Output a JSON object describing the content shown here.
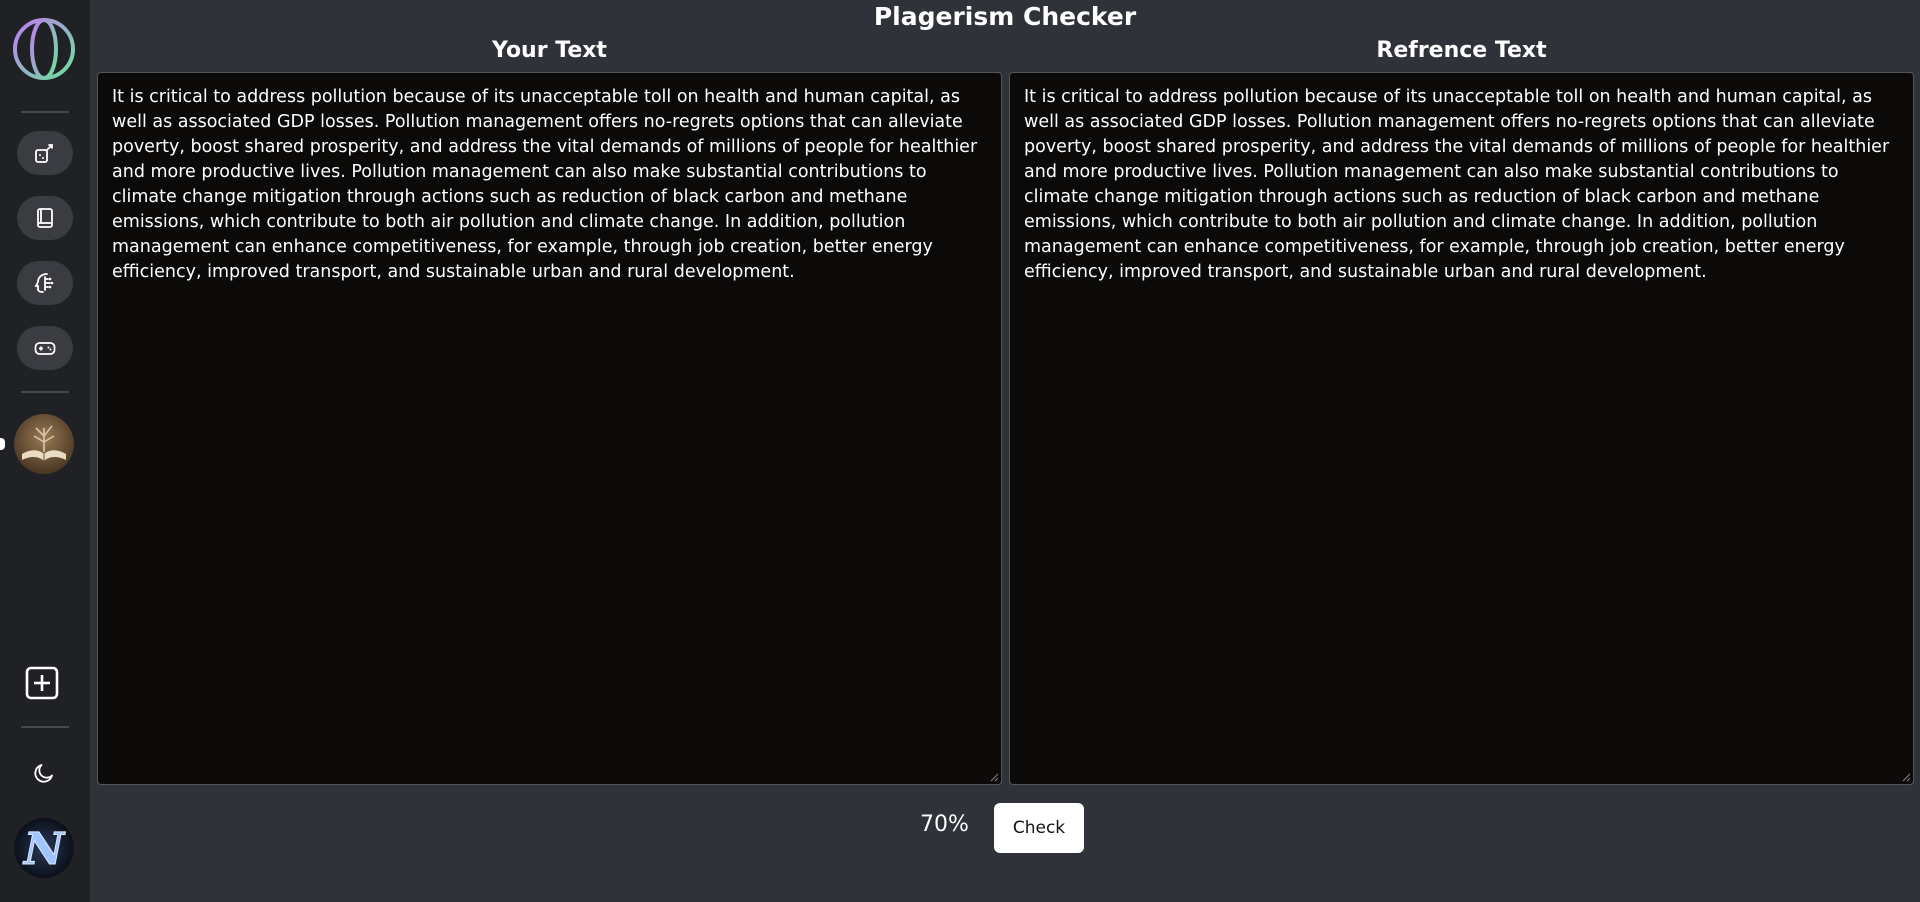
{
  "page": {
    "title": "Plagerism Checker"
  },
  "columns": {
    "left_title": "Your Text",
    "right_title": "Refrence Text"
  },
  "texts": {
    "your_text": "It is critical to address pollution because of its unacceptable toll on health and human capital, as well as associated GDP losses. Pollution management offers no-regrets options that can alleviate poverty, boost shared prosperity, and address the vital demands of millions of people for healthier and more productive lives. Pollution management can also make substantial contributions to climate change mitigation through actions such as reduction of black carbon and methane emissions, which contribute to both air pollution and climate change. In addition, pollution management can enhance competitiveness, for example, through job creation, better energy efficiency, improved transport, and sustainable urban and rural development.",
    "reference_text": "It is critical to address pollution because of its unacceptable toll on health and human capital, as well as associated GDP losses. Pollution management offers no-regrets options that can alleviate poverty, boost shared prosperity, and address the vital demands of millions of people for healthier and more productive lives. Pollution management can also make substantial contributions to climate change mitigation through actions such as reduction of black carbon and methane emissions, which contribute to both air pollution and climate change. In addition, pollution management can enhance competitiveness, for example, through job creation, better energy efficiency, improved transport, and sustainable urban and rural development."
  },
  "result": {
    "percent": "70%",
    "check_label": "Check"
  },
  "sidebar": {
    "items": [
      {
        "icon": "tools-icon"
      },
      {
        "icon": "book-icon"
      },
      {
        "icon": "brain-icon"
      },
      {
        "icon": "gamepad-icon"
      }
    ],
    "user_initial": "N"
  },
  "colors": {
    "background": "#30323a",
    "sidebar": "#1f2125",
    "panel": "#0b0a09",
    "button": "#ffffff"
  }
}
